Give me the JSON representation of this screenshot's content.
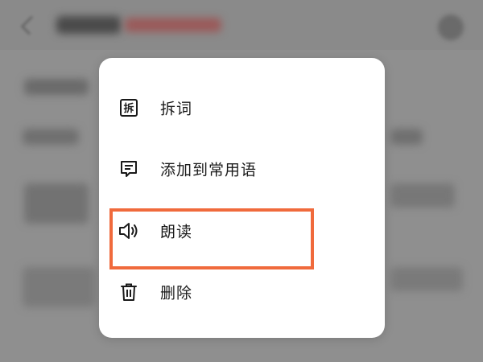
{
  "menu": {
    "items": [
      {
        "label": "拆词",
        "icon": "split-word-icon"
      },
      {
        "label": "添加到常用语",
        "icon": "add-phrase-icon"
      },
      {
        "label": "朗读",
        "icon": "speaker-icon"
      },
      {
        "label": "删除",
        "icon": "trash-icon"
      }
    ]
  },
  "colors": {
    "background_overlay": "#8f8f8f",
    "menu_background": "#ffffff",
    "highlight_border": "#f06a3c",
    "text": "#1a1a1a"
  }
}
